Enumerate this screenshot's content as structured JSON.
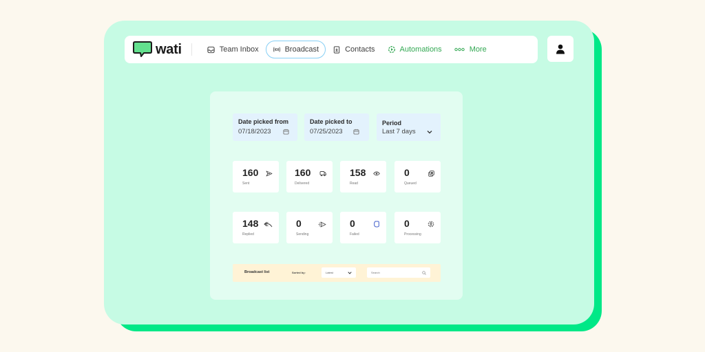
{
  "app": {
    "name": "wati"
  },
  "nav": {
    "items": [
      {
        "label": "Team Inbox",
        "icon": "inbox-icon",
        "active": false
      },
      {
        "label": "Broadcast",
        "icon": "broadcast-icon",
        "active": true
      },
      {
        "label": "Contacts",
        "icon": "contacts-icon",
        "active": false
      },
      {
        "label": "Automations",
        "icon": "automations-icon",
        "active": false
      },
      {
        "label": "More",
        "icon": "more-icon",
        "active": false
      }
    ],
    "profile_icon": "user-icon"
  },
  "filters": {
    "date_from": {
      "label": "Date picked from",
      "value": "07/18/2023"
    },
    "date_to": {
      "label": "Date picked to",
      "value": "07/25/2023"
    },
    "period": {
      "label": "Period",
      "value": "Last 7 days"
    }
  },
  "stats": [
    {
      "value": "160",
      "label": "Sent",
      "icon": "send-icon"
    },
    {
      "value": "160",
      "label": "Delivered",
      "icon": "delivered-icon"
    },
    {
      "value": "158",
      "label": "Read",
      "icon": "eye-icon"
    },
    {
      "value": "0",
      "label": "Queued",
      "icon": "queue-icon"
    },
    {
      "value": "148",
      "label": "Replied",
      "icon": "reply-icon"
    },
    {
      "value": "0",
      "label": "Sending",
      "icon": "sending-icon"
    },
    {
      "value": "0",
      "label": "Failed",
      "icon": "failed-icon"
    },
    {
      "value": "0",
      "label": "Processing",
      "icon": "processing-icon"
    }
  ],
  "broadcast_list": {
    "title": "Broadcast list",
    "sort_label": "Sorted by:",
    "sort_value": "Latest",
    "search_placeholder": "Search"
  },
  "colors": {
    "background": "#fcf8ee",
    "card": "#c6fbe4",
    "card_shadow": "#00e887",
    "accent_green": "#32a852",
    "active_border": "#86cff5"
  }
}
